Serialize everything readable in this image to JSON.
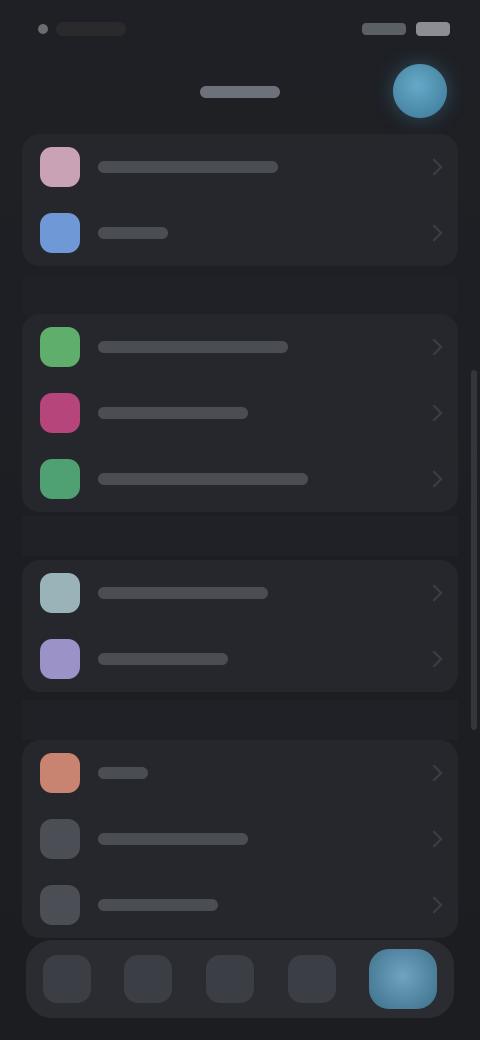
{
  "status_bar": {
    "time": "",
    "signal_icon": "signal-icon",
    "battery_icon": "battery-icon"
  },
  "header": {
    "title": "",
    "avatar_color": "#5aa0c0"
  },
  "groups": [
    {
      "items": [
        {
          "label": "",
          "icon": "profile-icon",
          "color": "#c9a2b6"
        },
        {
          "label": "",
          "icon": "cloud-icon",
          "color": "#6f98d6"
        }
      ]
    },
    {
      "items": [
        {
          "label": "",
          "icon": "notifications-icon",
          "color": "#5fae6c"
        },
        {
          "label": "",
          "icon": "heart-icon",
          "color": "#b5457a"
        },
        {
          "label": "",
          "icon": "security-icon",
          "color": "#4fa173"
        }
      ]
    },
    {
      "items": [
        {
          "label": "",
          "icon": "display-icon",
          "color": "#9ab3b8"
        },
        {
          "label": "",
          "icon": "wallpaper-icon",
          "color": "#9b92c8"
        }
      ]
    },
    {
      "items": [
        {
          "label": "",
          "icon": "gear-icon",
          "color": "#c88470"
        },
        {
          "label": "",
          "icon": "info-icon",
          "color": "#4b4e55"
        },
        {
          "label": "",
          "icon": "help-icon",
          "color": "#4b4e55"
        }
      ]
    }
  ],
  "dock": {
    "items": [
      {
        "icon": "home-icon"
      },
      {
        "icon": "search-icon"
      },
      {
        "icon": "library-icon"
      },
      {
        "icon": "chat-icon"
      },
      {
        "icon": "settings-icon"
      }
    ],
    "active_index": 4
  }
}
